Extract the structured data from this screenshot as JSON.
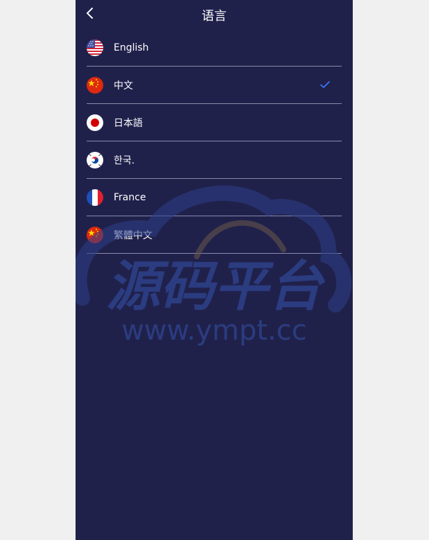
{
  "header": {
    "title": "语言",
    "back_icon": "chevron-left-icon"
  },
  "languages": [
    {
      "label": "English",
      "flag": "us-flag-icon",
      "selected": false
    },
    {
      "label": "中文",
      "flag": "cn-flag-icon",
      "selected": true
    },
    {
      "label": "日本語",
      "flag": "jp-flag-icon",
      "selected": false
    },
    {
      "label": "한국.",
      "flag": "kr-flag-icon",
      "selected": false
    },
    {
      "label": "France",
      "flag": "fr-flag-icon",
      "selected": false
    },
    {
      "label": "繁體中文",
      "flag": "tw-cn-flag-icon",
      "selected": false
    }
  ],
  "watermark": {
    "brand": "源码平台",
    "url": "www.ympt.cc"
  },
  "colors": {
    "background": "#20214b",
    "page": "#f0f0f0",
    "divider": "#8a8ba8",
    "check": "#3b7bff"
  }
}
